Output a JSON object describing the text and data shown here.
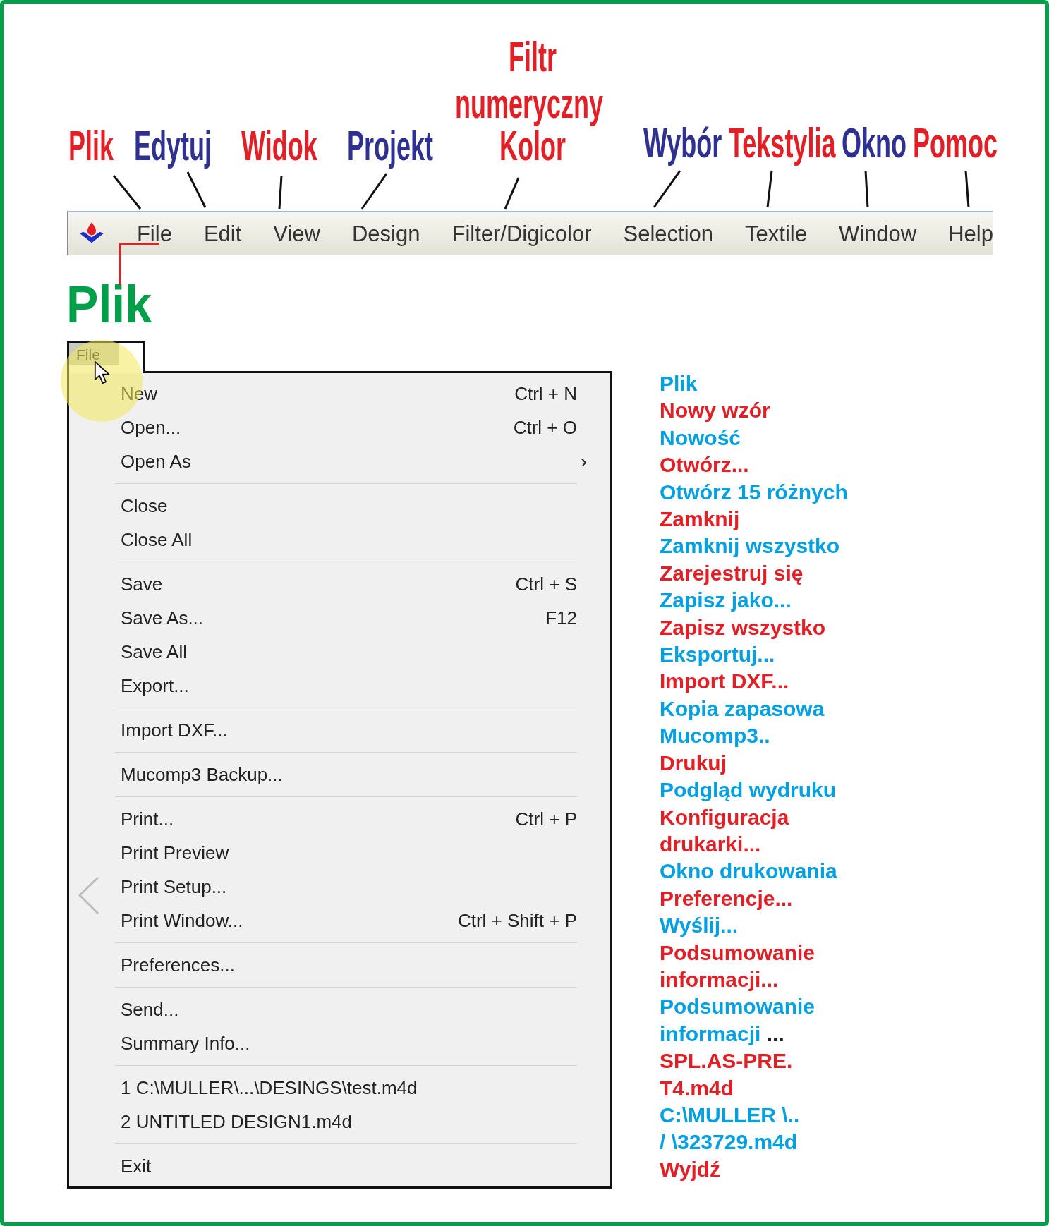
{
  "annotations": {
    "top_labels": [
      {
        "text": "Filtr",
        "color": "#e31e24"
      },
      {
        "text": "numeryczny",
        "color": "#e31e24"
      },
      {
        "text": "Plik",
        "color": "#e31e24"
      },
      {
        "text": "Edytuj",
        "color": "#2e3192"
      },
      {
        "text": "Widok",
        "color": "#e31e24"
      },
      {
        "text": "Projekt",
        "color": "#2e3192"
      },
      {
        "text": "Kolor",
        "color": "#e31e24"
      },
      {
        "text": "Wybór",
        "color": "#2e3192"
      },
      {
        "text": "Tekstylia",
        "color": "#e31e24"
      },
      {
        "text": "Okno",
        "color": "#2e3192"
      },
      {
        "text": "Pomoc",
        "color": "#e31e24"
      }
    ],
    "section_label": "Plik"
  },
  "menubar": {
    "items": [
      "File",
      "Edit",
      "View",
      "Design",
      "Filter/Digicolor",
      "Selection",
      "Textile",
      "Window",
      "Help"
    ]
  },
  "file_menu": {
    "tab_label": "File",
    "groups": [
      [
        {
          "label": "New",
          "shortcut": "Ctrl + N"
        },
        {
          "label": "Open...",
          "shortcut": "Ctrl + O"
        },
        {
          "label": "Open As",
          "arrow": "›"
        }
      ],
      [
        {
          "label": "Close"
        },
        {
          "label": "Close All"
        }
      ],
      [
        {
          "label": "Save",
          "shortcut": "Ctrl + S"
        },
        {
          "label": "Save As...",
          "shortcut": "F12"
        },
        {
          "label": "Save All"
        },
        {
          "label": "Export..."
        }
      ],
      [
        {
          "label": "Import DXF..."
        }
      ],
      [
        {
          "label": "Mucomp3 Backup..."
        }
      ],
      [
        {
          "label": "Print...",
          "shortcut": "Ctrl + P"
        },
        {
          "label": "Print Preview"
        },
        {
          "label": "Print Setup..."
        },
        {
          "label": "Print Window...",
          "shortcut": "Ctrl + Shift + P"
        }
      ],
      [
        {
          "label": "Preferences..."
        }
      ],
      [
        {
          "label": "Send..."
        },
        {
          "label": "Summary Info..."
        }
      ],
      [
        {
          "label": "1 C:\\MULLER\\...\\DESINGS\\test.m4d"
        },
        {
          "label": "2 UNTITLED DESIGN1.m4d"
        }
      ],
      [
        {
          "label": "Exit"
        }
      ]
    ]
  },
  "translations": [
    {
      "text": "Plik",
      "color": "#00a0e3"
    },
    {
      "text": "Nowy wzór",
      "color": "#e31e24"
    },
    {
      "text": "Nowość",
      "color": "#00a0e3"
    },
    {
      "text": "Otwórz...",
      "color": "#e31e24"
    },
    {
      "text": "Otwórz 15 różnych",
      "color": "#00a0e3"
    },
    {
      "text": "Zamknij",
      "color": "#e31e24"
    },
    {
      "text": "Zamknij wszystko",
      "color": "#00a0e3"
    },
    {
      "text": "Zarejestruj się",
      "color": "#e31e24"
    },
    {
      "text": "Zapisz jako...",
      "color": "#00a0e3"
    },
    {
      "text": "Zapisz wszystko",
      "color": "#e31e24"
    },
    {
      "text": "Eksportuj...",
      "color": "#00a0e3"
    },
    {
      "text": "Import DXF...",
      "color": "#e31e24"
    },
    {
      "text": "Kopia zapasowa",
      "color": "#00a0e3"
    },
    {
      "text": "Mucomp3..",
      "color": "#00a0e3"
    },
    {
      "text": "Drukuj",
      "color": "#e31e24"
    },
    {
      "text": "Podgląd wydruku",
      "color": "#00a0e3"
    },
    {
      "text": "Konfiguracja",
      "color": "#e31e24"
    },
    {
      "text": "drukarki...",
      "color": "#e31e24"
    },
    {
      "text": "Okno drukowania",
      "color": "#00a0e3"
    },
    {
      "text": "Preferencje...",
      "color": "#e31e24"
    },
    {
      "text": "Wyślij...",
      "color": "#00a0e3"
    },
    {
      "text": "Podsumowanie",
      "color": "#e31e24"
    },
    {
      "text": "informacji...",
      "color": "#e31e24"
    },
    {
      "text": "Podsumowanie",
      "color": "#00a0e3"
    },
    {
      "text": "informacji",
      "color": "#00a0e3",
      "suffix": " ..."
    },
    {
      "text": "SPL.AS-PRE.",
      "color": "#e31e24"
    },
    {
      "text": "T4.m4d",
      "color": "#e31e24"
    },
    {
      "text": "C:\\MULLER \\..",
      "color": "#00a0e3"
    },
    {
      "text": "/ \\323729.m4d",
      "color": "#00a0e3"
    },
    {
      "text": "Wyjdź",
      "color": "#e31e24"
    }
  ]
}
